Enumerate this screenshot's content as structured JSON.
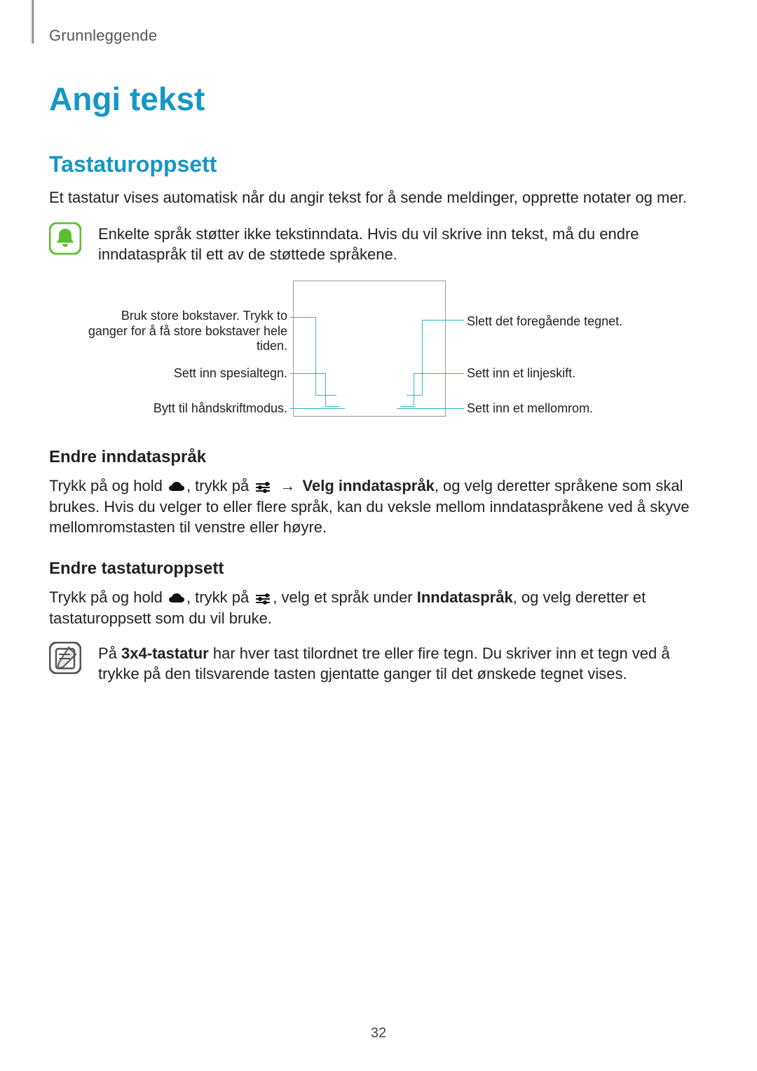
{
  "breadcrumb": "Grunnleggende",
  "h1": "Angi tekst",
  "h2": "Tastaturoppsett",
  "intro": "Et tastatur vises automatisk når du angir tekst for å sende meldinger, opprette notater og mer.",
  "note1": "Enkelte språk støtter ikke tekstinndata. Hvis du vil skrive inn tekst, må du endre inndataspråk til ett av de støttede språkene.",
  "diagram": {
    "left1": "Bruk store bokstaver. Trykk to ganger for å få store bokstaver hele tiden.",
    "left2": "Sett inn spesialtegn.",
    "left3": "Bytt til håndskriftmodus.",
    "right1": "Slett det foregående tegnet.",
    "right2": "Sett inn et linjeskift.",
    "right3": "Sett inn et mellomrom."
  },
  "h3a": "Endre inndataspråk",
  "para_a_pre": "Trykk på og hold ",
  "para_a_mid1": ", trykk på ",
  "arrow": " → ",
  "para_a_bold": "Velg inndataspråk",
  "para_a_post": ", og velg deretter språkene som skal brukes. Hvis du velger to eller flere språk, kan du veksle mellom inndataspråkene ved å skyve mellomromstasten til venstre eller høyre.",
  "h3b": "Endre tastaturoppsett",
  "para_b_pre": "Trykk på og hold ",
  "para_b_mid1": ", trykk på ",
  "para_b_mid2": ", velg et språk under ",
  "para_b_bold": "Inndataspråk",
  "para_b_post": ", og velg deretter et tastaturoppsett som du vil bruke.",
  "note2_pre": "På ",
  "note2_bold": "3x4-tastatur",
  "note2_post": " har hver tast tilordnet tre eller fire tegn. Du skriver inn et tegn ved å trykke på den tilsvarende tasten gjentatte ganger til det ønskede tegnet vises.",
  "page_number": "32"
}
